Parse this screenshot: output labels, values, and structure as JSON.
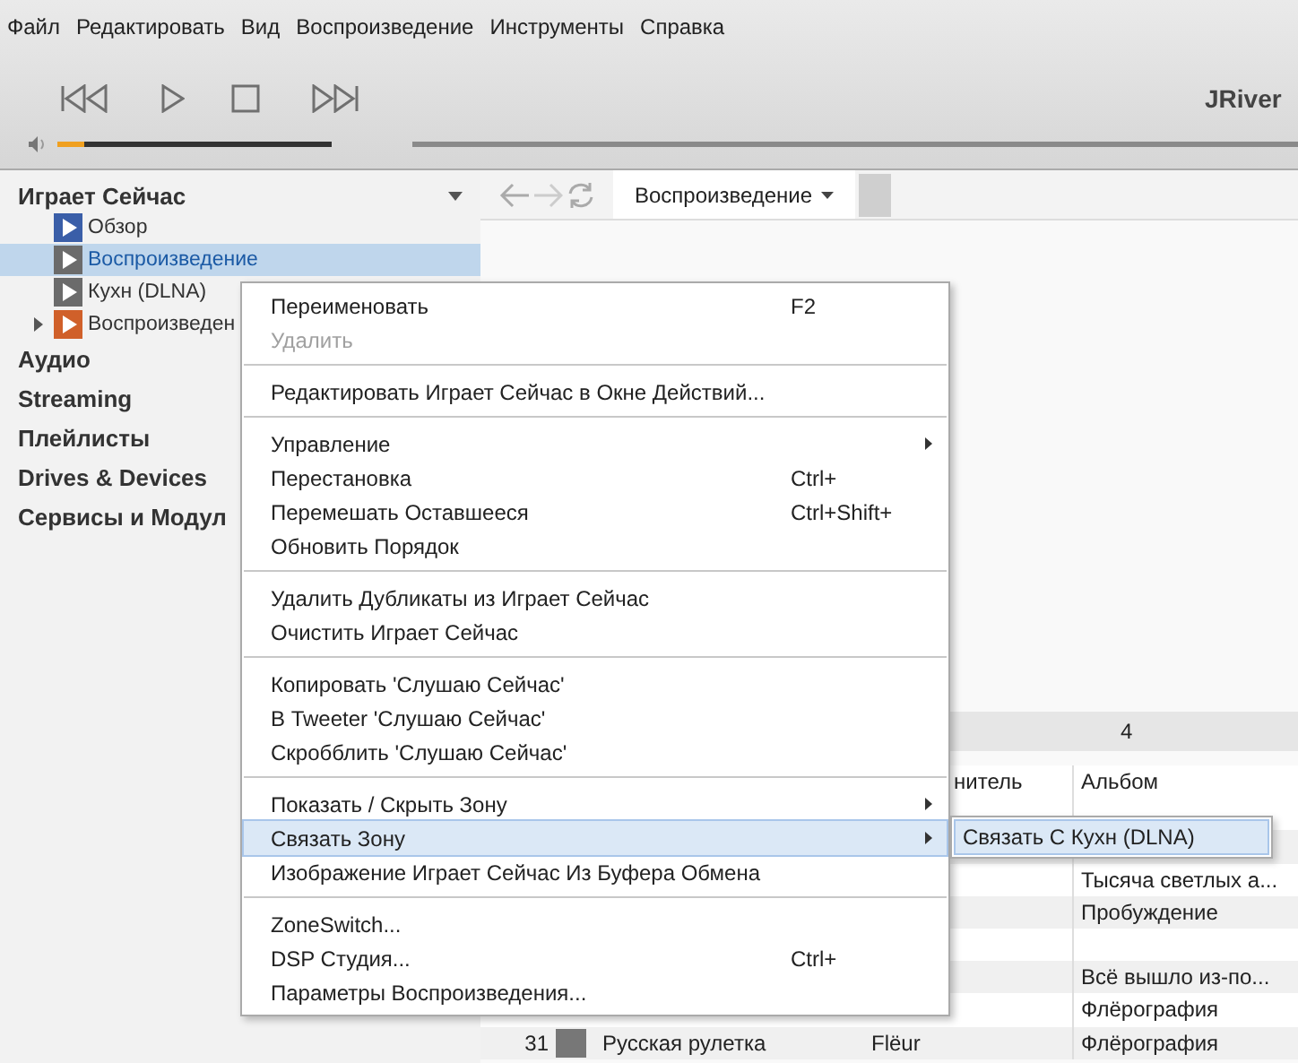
{
  "menu_bar": [
    "Файл",
    "Редактировать",
    "Вид",
    "Воспроизведение",
    "Инструменты",
    "Справка"
  ],
  "app_title": "JRiver",
  "volume": {
    "level": 0.1
  },
  "sidebar": {
    "header": "Играет Сейчас",
    "items": [
      {
        "label": "Обзор",
        "selected": false,
        "color": "#3a5ea8",
        "expandable": false
      },
      {
        "label": "Воспроизведение",
        "selected": true,
        "color": "#6b6b6b",
        "expandable": false
      },
      {
        "label": "Кухн (DLNA)",
        "selected": false,
        "color": "#6b6b6b",
        "expandable": false
      },
      {
        "label": "Воспроизведен",
        "selected": false,
        "color": "#d0602a",
        "expandable": true
      }
    ],
    "sections": [
      "Аудио",
      "Streaming",
      "Плейлисты",
      "Drives & Devices",
      "Сервисы и Модул"
    ]
  },
  "view_tab": {
    "label": "Воспроизведение",
    "selected": true
  },
  "table": {
    "group_headers": [
      "4"
    ],
    "columns": [
      "нитель",
      "Альбом"
    ],
    "rows": [
      {},
      {},
      {
        "album": "Тысяча светлых а..."
      },
      {
        "album": "Пробуждение"
      },
      {},
      {
        "album": "Всё вышло из-по..."
      },
      {
        "album": "Флёрография"
      },
      {
        "number": "31",
        "title": "Русская рулетка",
        "artist": "Flëur",
        "album": "Флёрография"
      }
    ]
  },
  "context_menu": [
    {
      "kind": "item",
      "label": "Переименовать",
      "shortcut": "F2",
      "disabled": false,
      "submenu": false,
      "selected": false
    },
    {
      "kind": "item",
      "label": "Удалить",
      "disabled": true,
      "submenu": false,
      "selected": false
    },
    {
      "kind": "separator"
    },
    {
      "kind": "item",
      "label": "Редактировать Играет Сейчас в Окне Действий...",
      "disabled": false,
      "submenu": false,
      "selected": false
    },
    {
      "kind": "separator"
    },
    {
      "kind": "item",
      "label": "Управление",
      "disabled": false,
      "submenu": true,
      "selected": false
    },
    {
      "kind": "item",
      "label": "Перестановка",
      "shortcut": "Ctrl+",
      "disabled": false,
      "submenu": false,
      "selected": false
    },
    {
      "kind": "item",
      "label": "Перемешать Оставшееся",
      "shortcut": "Ctrl+Shift+",
      "disabled": false,
      "submenu": false,
      "selected": false
    },
    {
      "kind": "item",
      "label": "Обновить Порядок",
      "disabled": false,
      "submenu": false,
      "selected": false
    },
    {
      "kind": "separator"
    },
    {
      "kind": "item",
      "label": "Удалить Дубликаты из Играет Сейчас",
      "disabled": false,
      "submenu": false,
      "selected": false
    },
    {
      "kind": "item",
      "label": "Очистить Играет Сейчас",
      "disabled": false,
      "submenu": false,
      "selected": false
    },
    {
      "kind": "separator"
    },
    {
      "kind": "item",
      "label": "Копировать 'Слушаю Сейчас'",
      "disabled": false,
      "submenu": false,
      "selected": false
    },
    {
      "kind": "item",
      "label": "В Tweeter 'Слушаю Сейчас'",
      "disabled": false,
      "submenu": false,
      "selected": false
    },
    {
      "kind": "item",
      "label": "Скробблить 'Слушаю Сейчас'",
      "disabled": false,
      "submenu": false,
      "selected": false
    },
    {
      "kind": "separator"
    },
    {
      "kind": "item",
      "label": "Показать / Скрыть Зону",
      "disabled": false,
      "submenu": true,
      "selected": false
    },
    {
      "kind": "item",
      "label": "Связать Зону",
      "disabled": false,
      "submenu": true,
      "selected": true
    },
    {
      "kind": "item",
      "label": "Изображение Играет Сейчас Из Буфера Обмена",
      "disabled": false,
      "submenu": false,
      "selected": false
    },
    {
      "kind": "separator"
    },
    {
      "kind": "item",
      "label": "ZoneSwitch...",
      "disabled": false,
      "submenu": false,
      "selected": false
    },
    {
      "kind": "item",
      "label": "DSP Студия...",
      "shortcut": "Ctrl+",
      "disabled": false,
      "submenu": false,
      "selected": false
    },
    {
      "kind": "item",
      "label": "Параметры Воспроизведения...",
      "disabled": false,
      "submenu": false,
      "selected": false
    }
  ],
  "submenu": [
    {
      "label": "Связать С Кухн (DLNA)",
      "selected": true
    }
  ]
}
